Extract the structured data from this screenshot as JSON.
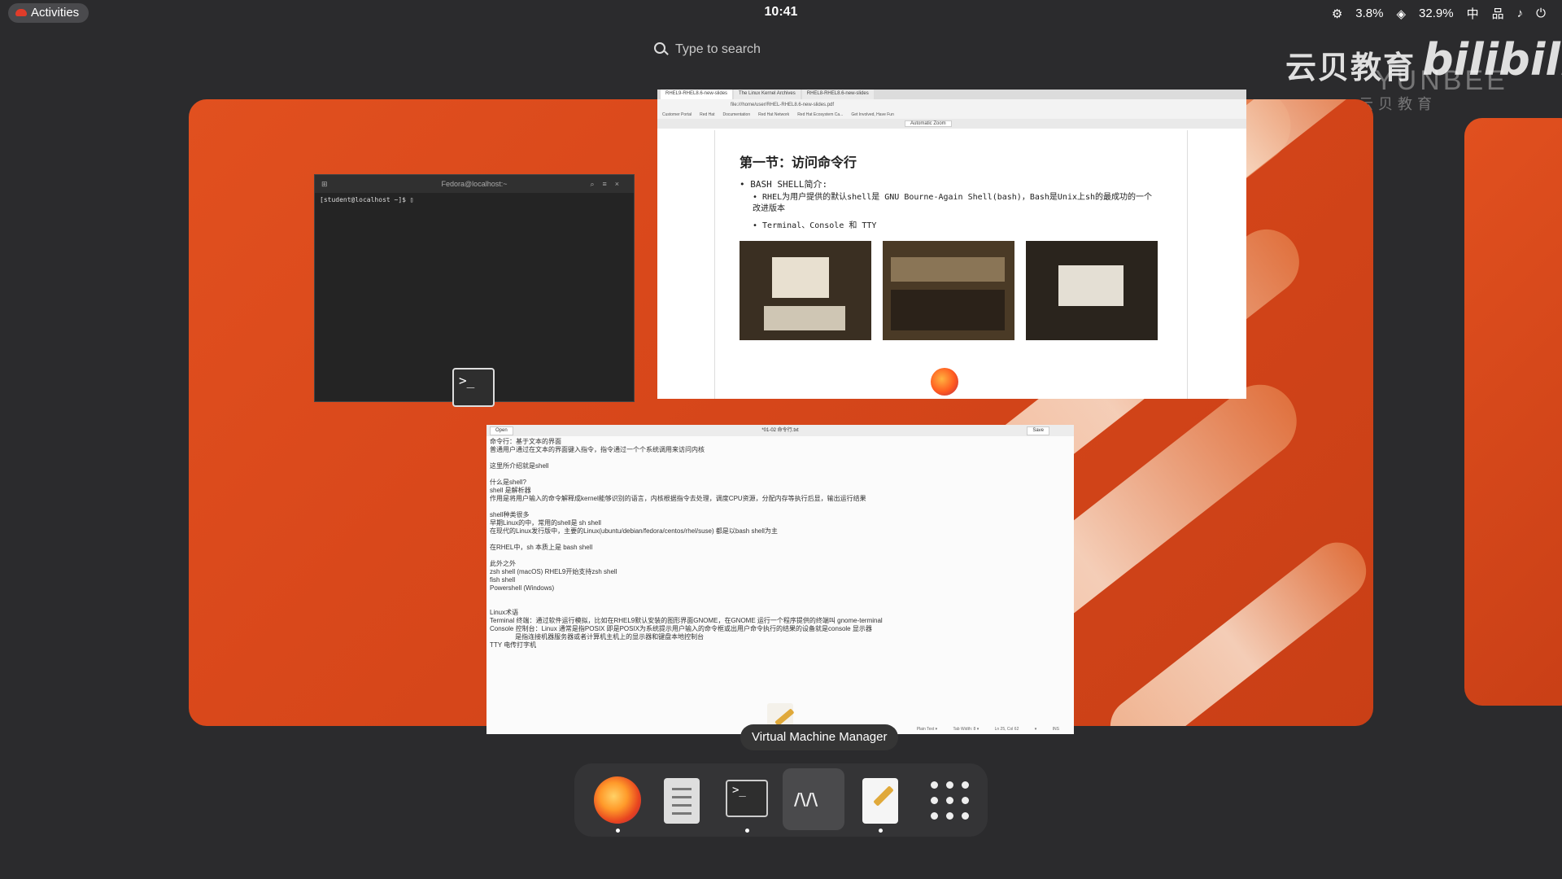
{
  "topbar": {
    "activities": "Activities",
    "clock": "10:41",
    "cpu": "3.8%",
    "mem": "32.9%",
    "ime": "中"
  },
  "search": {
    "placeholder": "Type to search"
  },
  "watermark": {
    "brand_cn": "云贝教育",
    "brand_en": "YUNBEE",
    "brand_cn_small": "云贝教育",
    "bilibili": "bilibili"
  },
  "terminal": {
    "title": "Fedora@localhost:~",
    "prompt": "[student@localhost ~]$ ▯"
  },
  "browser": {
    "tabs": [
      "RHEL9-RHEL8.6-new-slides",
      "The Linux Kernel Archives",
      "RHEL8-RHEL8.6-new-slides"
    ],
    "url": "file:///home/user/RHEL-RHEL8.6-new-slides.pdf",
    "bookmarks": [
      "Customer Portal",
      "Red Hat",
      "Documentation",
      "Red Hat Network",
      "Red Hat Ecosystem Ca...",
      "Get Involved, Have Fun"
    ],
    "zoom": "Automatic Zoom",
    "heading": "第一节：访问命令行",
    "bullet1": "• BASH SHELL简介:",
    "bullet2": "• RHEL为用户提供的默认shell是 GNU Bourne-Again Shell(bash)，Bash是Unix上sh的最成功的一个改进版本",
    "bullet3": "• Terminal、Console 和 TTY"
  },
  "editor": {
    "open_label": "Open",
    "title": "*01-02 命令行.txt",
    "save_label": "Save",
    "lines": [
      "命令行：基于文本的界面",
      "普通用户通过在文本的界面键入指令，指令通过一个个系统调用来访问内核",
      "",
      "这里所介绍就是shell",
      "",
      "什么是shell?",
      "shell 是解析器",
      "作用是将用户输入的命令解释成kernel能够识别的语言，内核根据指令去处理，调度CPU资源，分配内存等执行后显，输出运行结果",
      "",
      "shell种类很多",
      "早期Linux的中，常用的shell是 sh shell",
      "在现代的Linux发行版中，主要的Linux(ubuntu/debian/fedora/centos/rhel/suse) 都是以bash shell为主",
      "",
      "在RHEL中，sh 本质上是 bash shell",
      "",
      "此外之外",
      "zsh shell (macOS) RHEL9开始支持zsh shell",
      "fish shell",
      "Powershell (Windows)",
      "",
      "",
      "Linux术语",
      "Terminal 终端：通过软件运行模拟，比如在RHEL9默认安装的图形界面GNOME，在GNOME 运行一个程序提供的终端叫 gnome-terminal",
      "Console 控制台：Linux 通常是指POSIX 即是POSIX为系统提示用户输入的命令框或出用户命令执行的结果的设备就是console 显示器",
      "              是指连接机器服务器或者计算机主机上的显示器和键盘本地控制台",
      "TTY 电传打字机"
    ],
    "footer": [
      "Plain Text ▾",
      "Tab Width: 8 ▾",
      "Ln 25, Col 62",
      "▾",
      "INS"
    ]
  },
  "tooltip": "Virtual Machine Manager",
  "dock": {
    "apps": [
      "firefox",
      "files",
      "terminal",
      "virtual-machine-manager",
      "text-editor",
      "show-apps"
    ]
  },
  "colors": {
    "accent": "#e1501f",
    "panel": "#2b2b2d"
  }
}
